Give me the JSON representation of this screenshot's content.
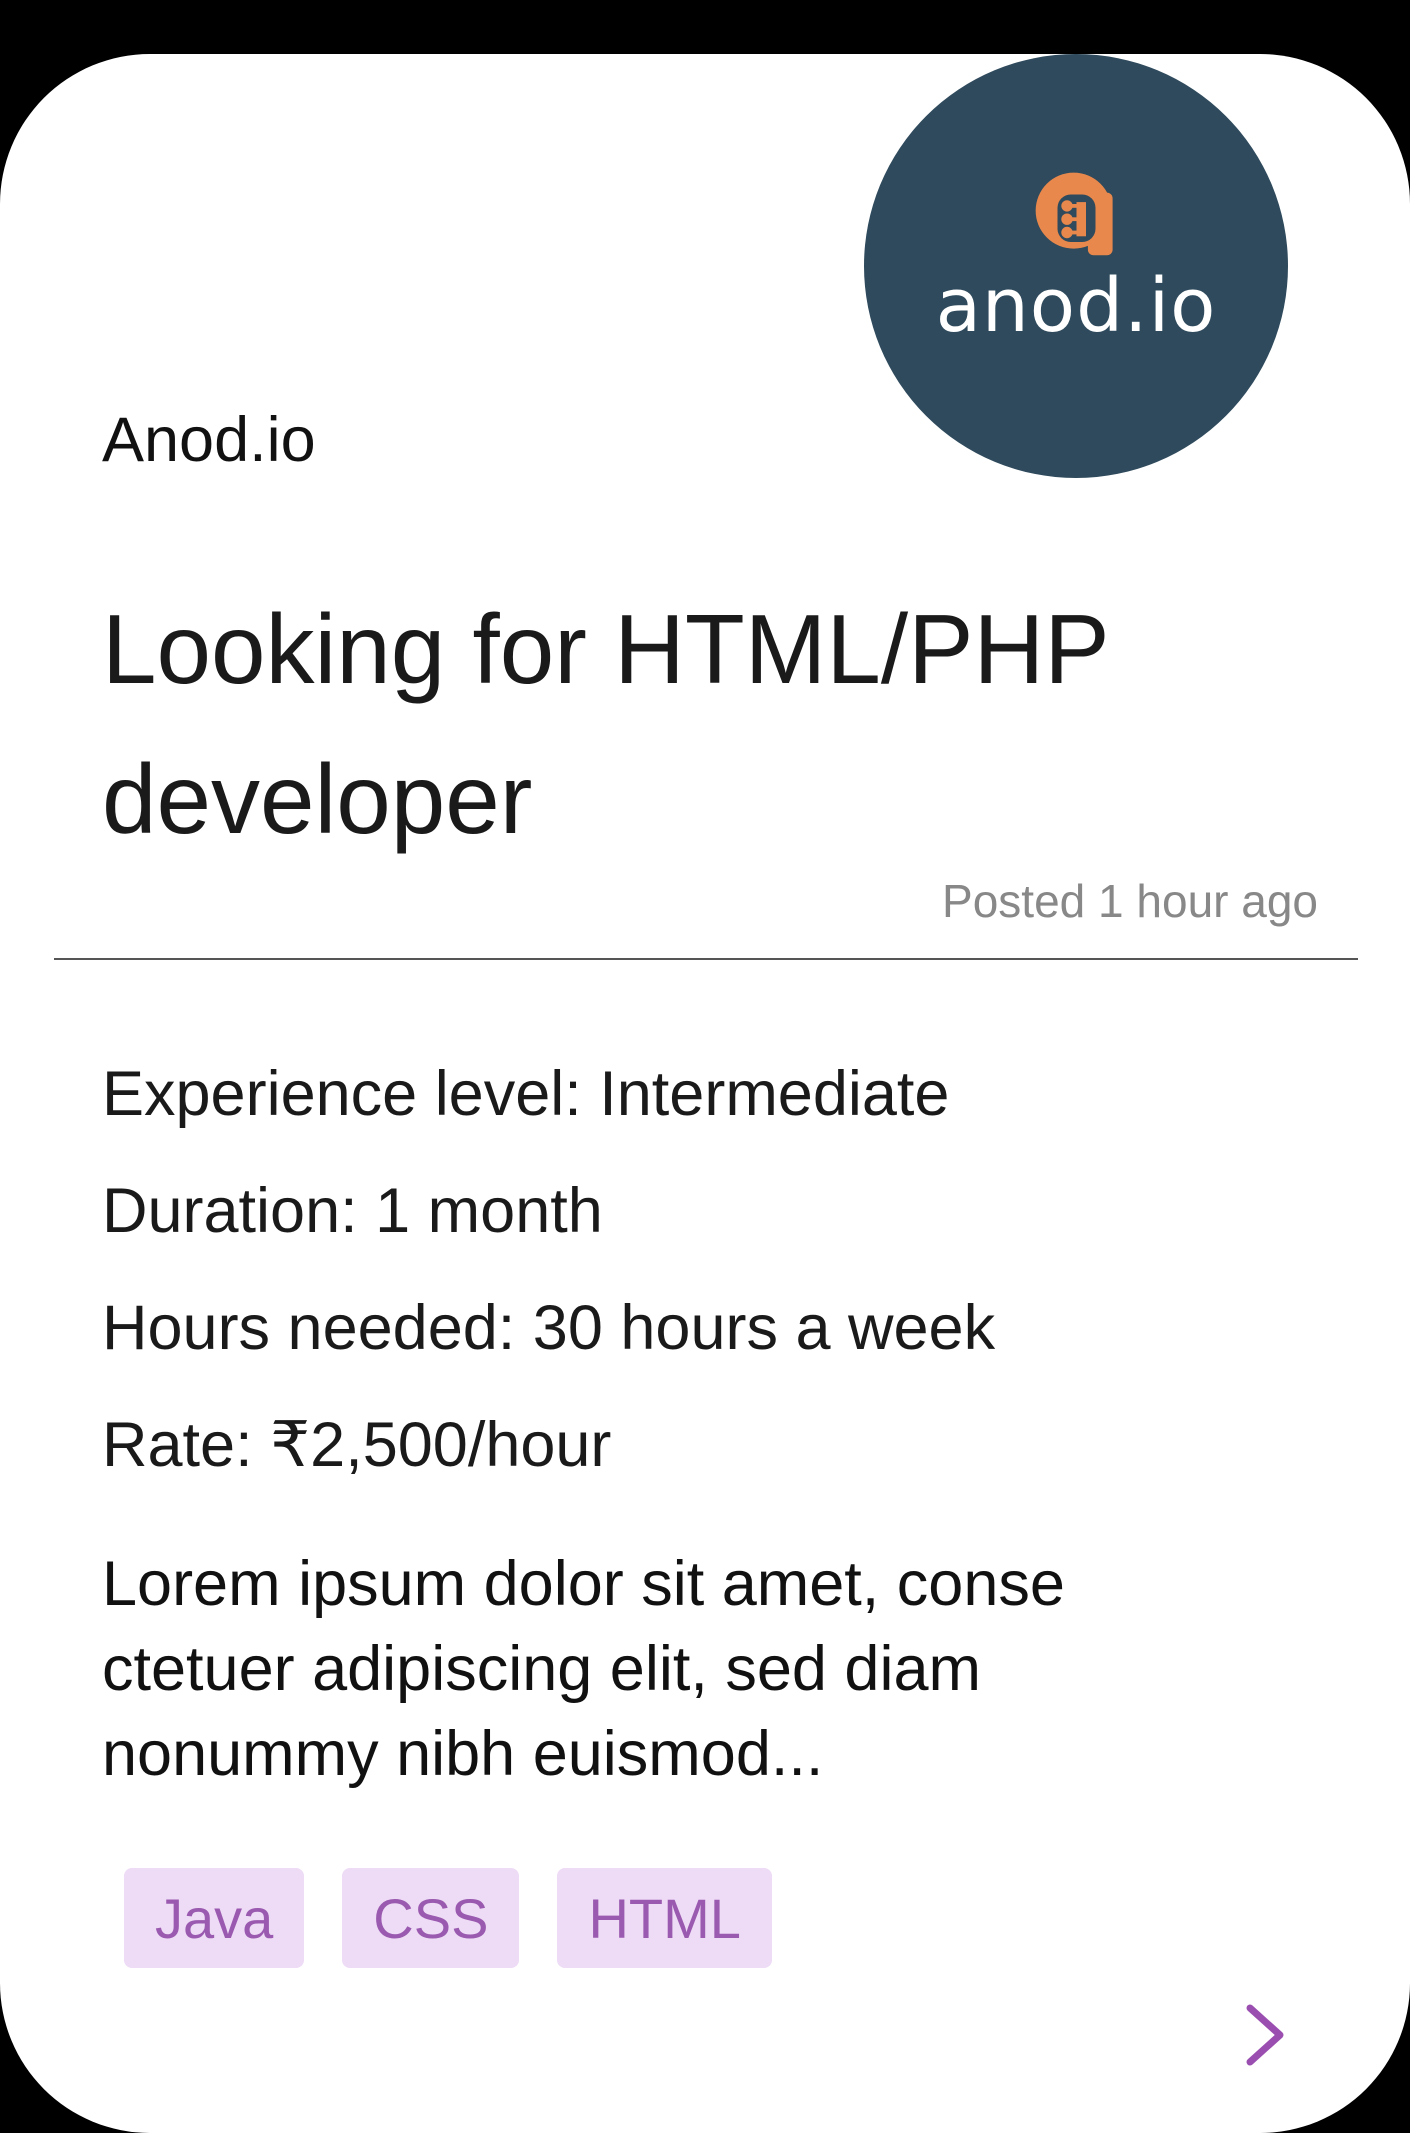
{
  "logo": {
    "text": "anod.io",
    "icon": "anod-logo-glyph",
    "bg_color": "#2e4a5c",
    "accent_color": "#e8884c"
  },
  "job": {
    "company": "Anod.io",
    "title": "Looking for HTML/PHP developer",
    "posted": "Posted 1 hour ago",
    "experience": "Experience level: Intermediate",
    "duration": "Duration: 1 month",
    "hours": "Hours needed: 30 hours a week",
    "rate": "Rate: ₹2,500/hour",
    "description": "Lorem ipsum dolor sit amet, conse ctetuer adipiscing elit, sed diam nonummy nibh euismod..."
  },
  "tags": [
    "Java",
    "CSS",
    "HTML"
  ],
  "nav": {
    "next_icon": "chevron-right-icon",
    "accent_color": "#9a4fb0"
  }
}
